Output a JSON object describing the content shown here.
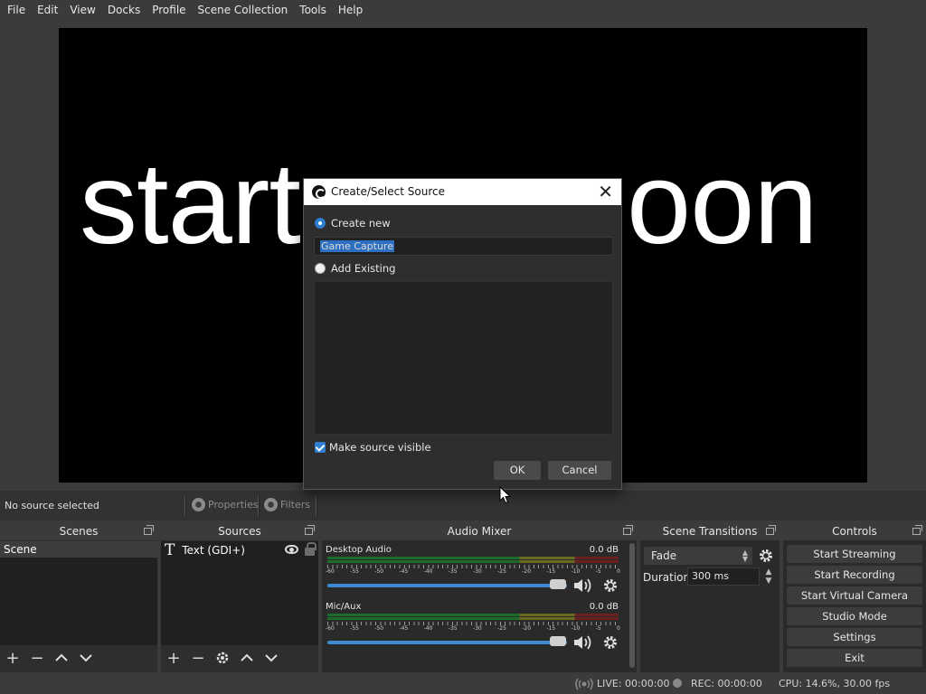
{
  "menu": [
    "File",
    "Edit",
    "View",
    "Docks",
    "Profile",
    "Scene Collection",
    "Tools",
    "Help"
  ],
  "preview": {
    "text_left": "start",
    "text_right": "oon"
  },
  "context": {
    "no_source": "No source selected",
    "properties": "Properties",
    "filters": "Filters"
  },
  "scenes": {
    "title": "Scenes",
    "items": [
      "Scene"
    ]
  },
  "sources": {
    "title": "Sources",
    "items": [
      {
        "name": "Text (GDI+)",
        "icon": "text-icon"
      }
    ]
  },
  "mixer": {
    "title": "Audio Mixer",
    "tick_labels": [
      "-60",
      "-55",
      "-50",
      "-45",
      "-40",
      "-35",
      "-30",
      "-25",
      "-20",
      "-15",
      "-10",
      "-5",
      "0"
    ],
    "channels": [
      {
        "name": "Desktop Audio",
        "db": "0.0 dB"
      },
      {
        "name": "Mic/Aux",
        "db": "0.0 dB"
      }
    ]
  },
  "transitions": {
    "title": "Scene Transitions",
    "selected": "Fade",
    "duration_label": "Duration",
    "duration_value": "300 ms"
  },
  "controls": {
    "title": "Controls",
    "buttons": [
      "Start Streaming",
      "Start Recording",
      "Start Virtual Camera",
      "Studio Mode",
      "Settings",
      "Exit"
    ]
  },
  "status": {
    "live": "LIVE: 00:00:00",
    "rec": "REC: 00:00:00",
    "cpu": "CPU: 14.6%, 30.00 fps"
  },
  "dialog": {
    "title": "Create/Select Source",
    "create_new": "Create new",
    "name_value": "Game Capture",
    "add_existing": "Add Existing",
    "make_visible": "Make source visible",
    "ok": "OK",
    "cancel": "Cancel"
  }
}
